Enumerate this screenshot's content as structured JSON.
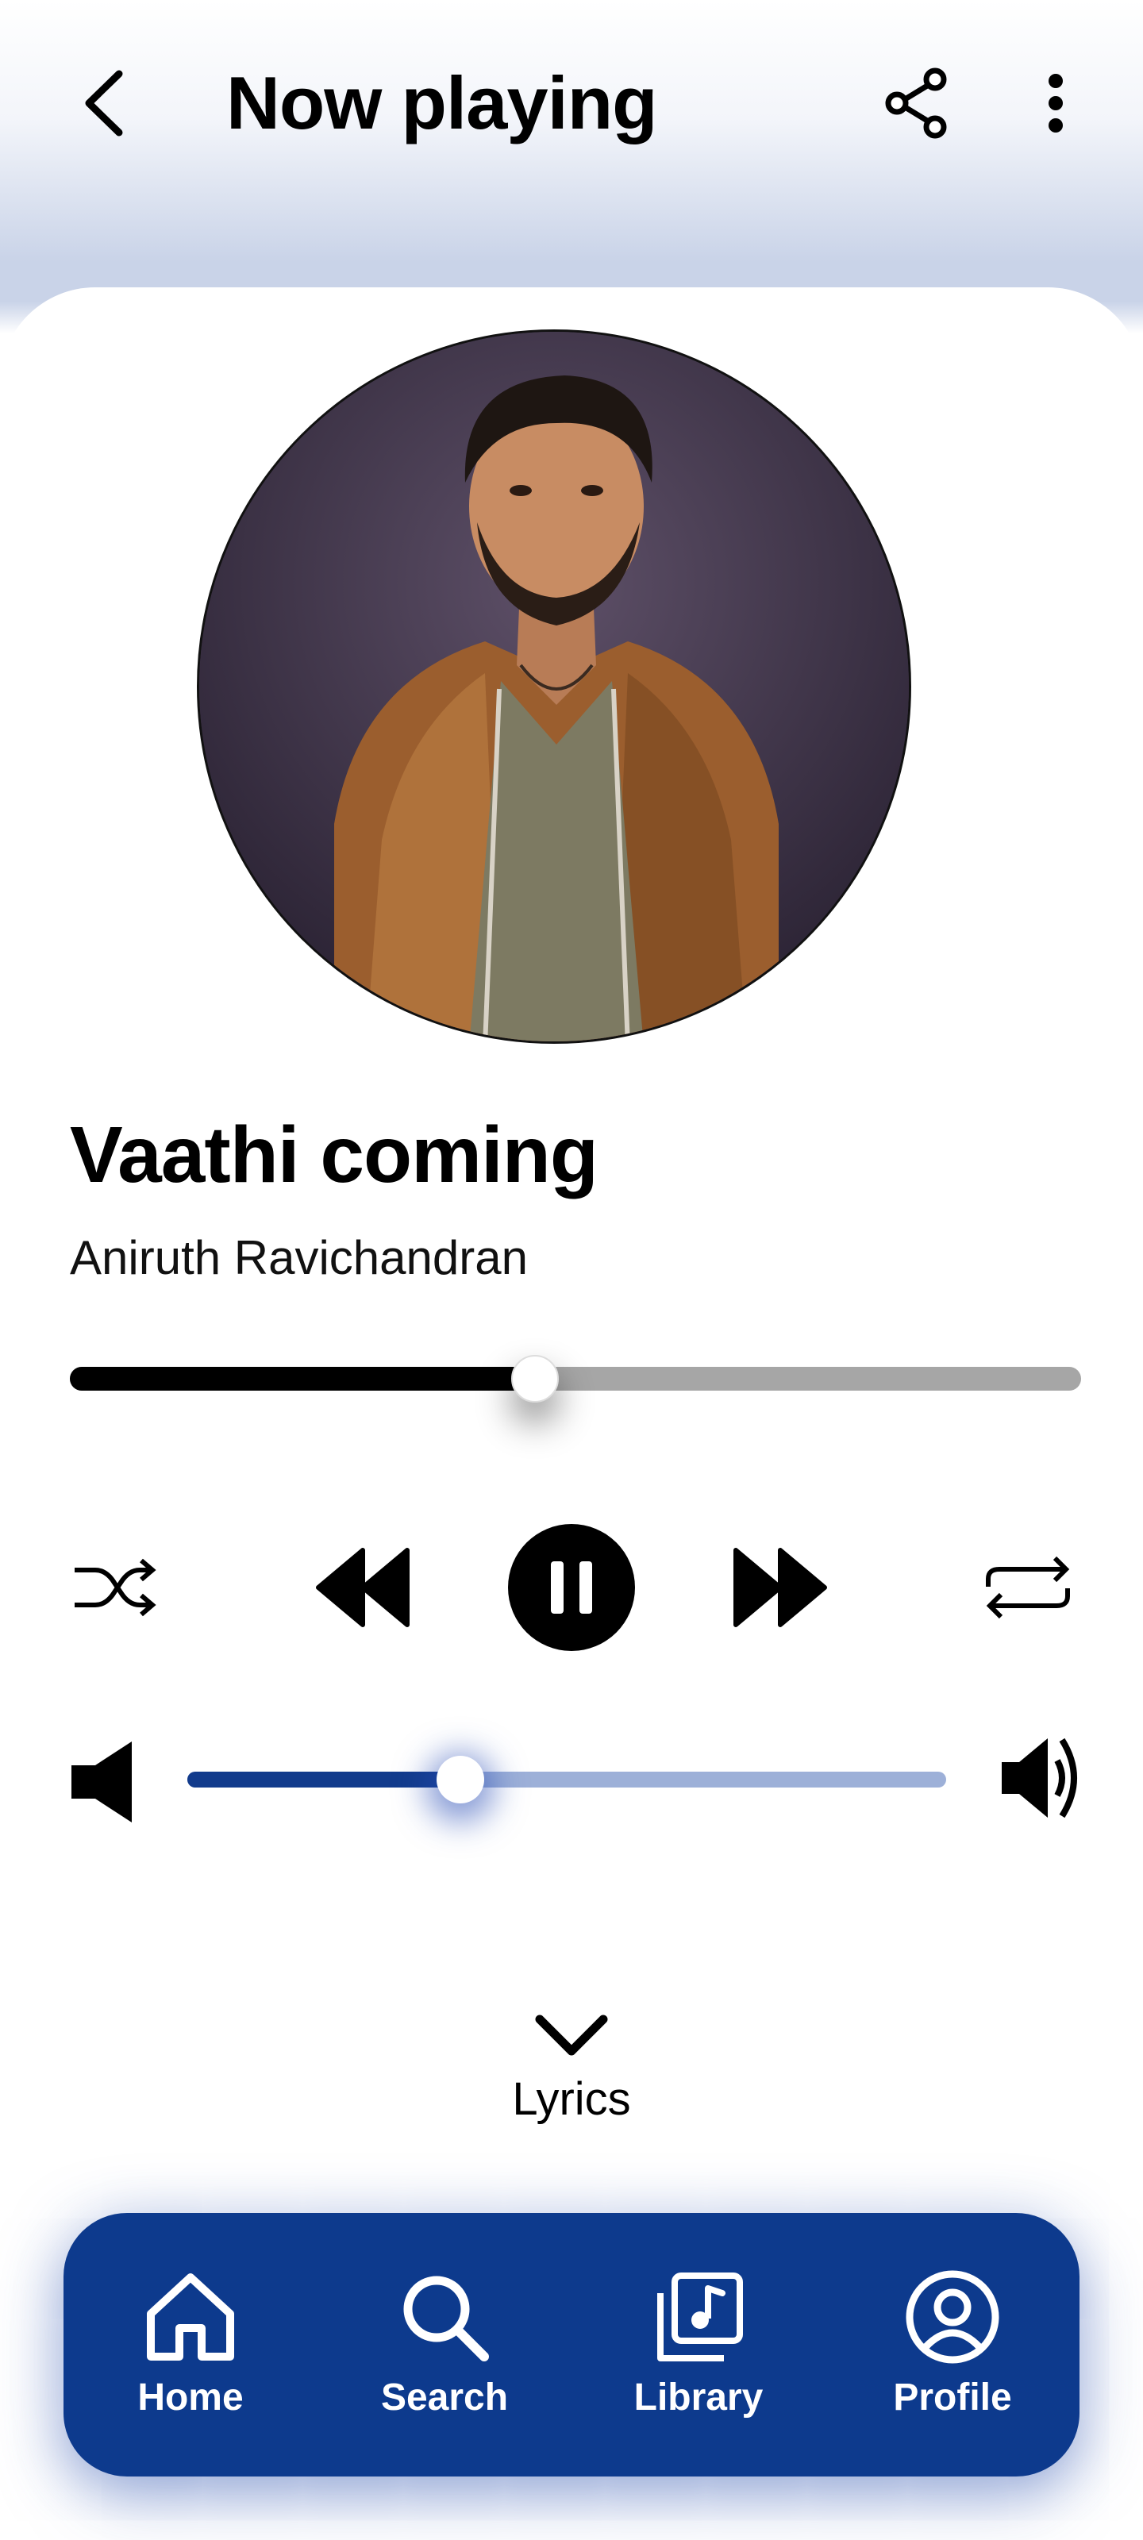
{
  "header": {
    "title": "Now playing",
    "back_icon": "chevron-left-icon",
    "share_icon": "share-icon",
    "more_icon": "more-vertical-icon"
  },
  "track": {
    "title": "Vaathi coming",
    "artist": "Aniruth Ravichandran",
    "progress_fraction": 0.46,
    "album_art": "circular portrait of artist in orange jacket"
  },
  "controls": {
    "shuffle_icon": "shuffle-icon",
    "previous_icon": "rewind-icon",
    "pause_icon": "pause-icon",
    "next_icon": "fast-forward-icon",
    "repeat_icon": "repeat-icon"
  },
  "volume": {
    "level_fraction": 0.36,
    "low_icon": "volume-low-icon",
    "high_icon": "volume-high-icon"
  },
  "lyrics": {
    "label": "Lyrics",
    "icon": "chevron-down-icon"
  },
  "nav": {
    "items": [
      {
        "label": "Home",
        "icon": "home-icon"
      },
      {
        "label": "Search",
        "icon": "search-icon"
      },
      {
        "label": "Library",
        "icon": "library-icon"
      },
      {
        "label": "Profile",
        "icon": "profile-icon"
      }
    ]
  },
  "colors": {
    "accent": "#0d3a8d",
    "volume_track": "#9db0d8",
    "progress_track": "#a6a6a6"
  }
}
